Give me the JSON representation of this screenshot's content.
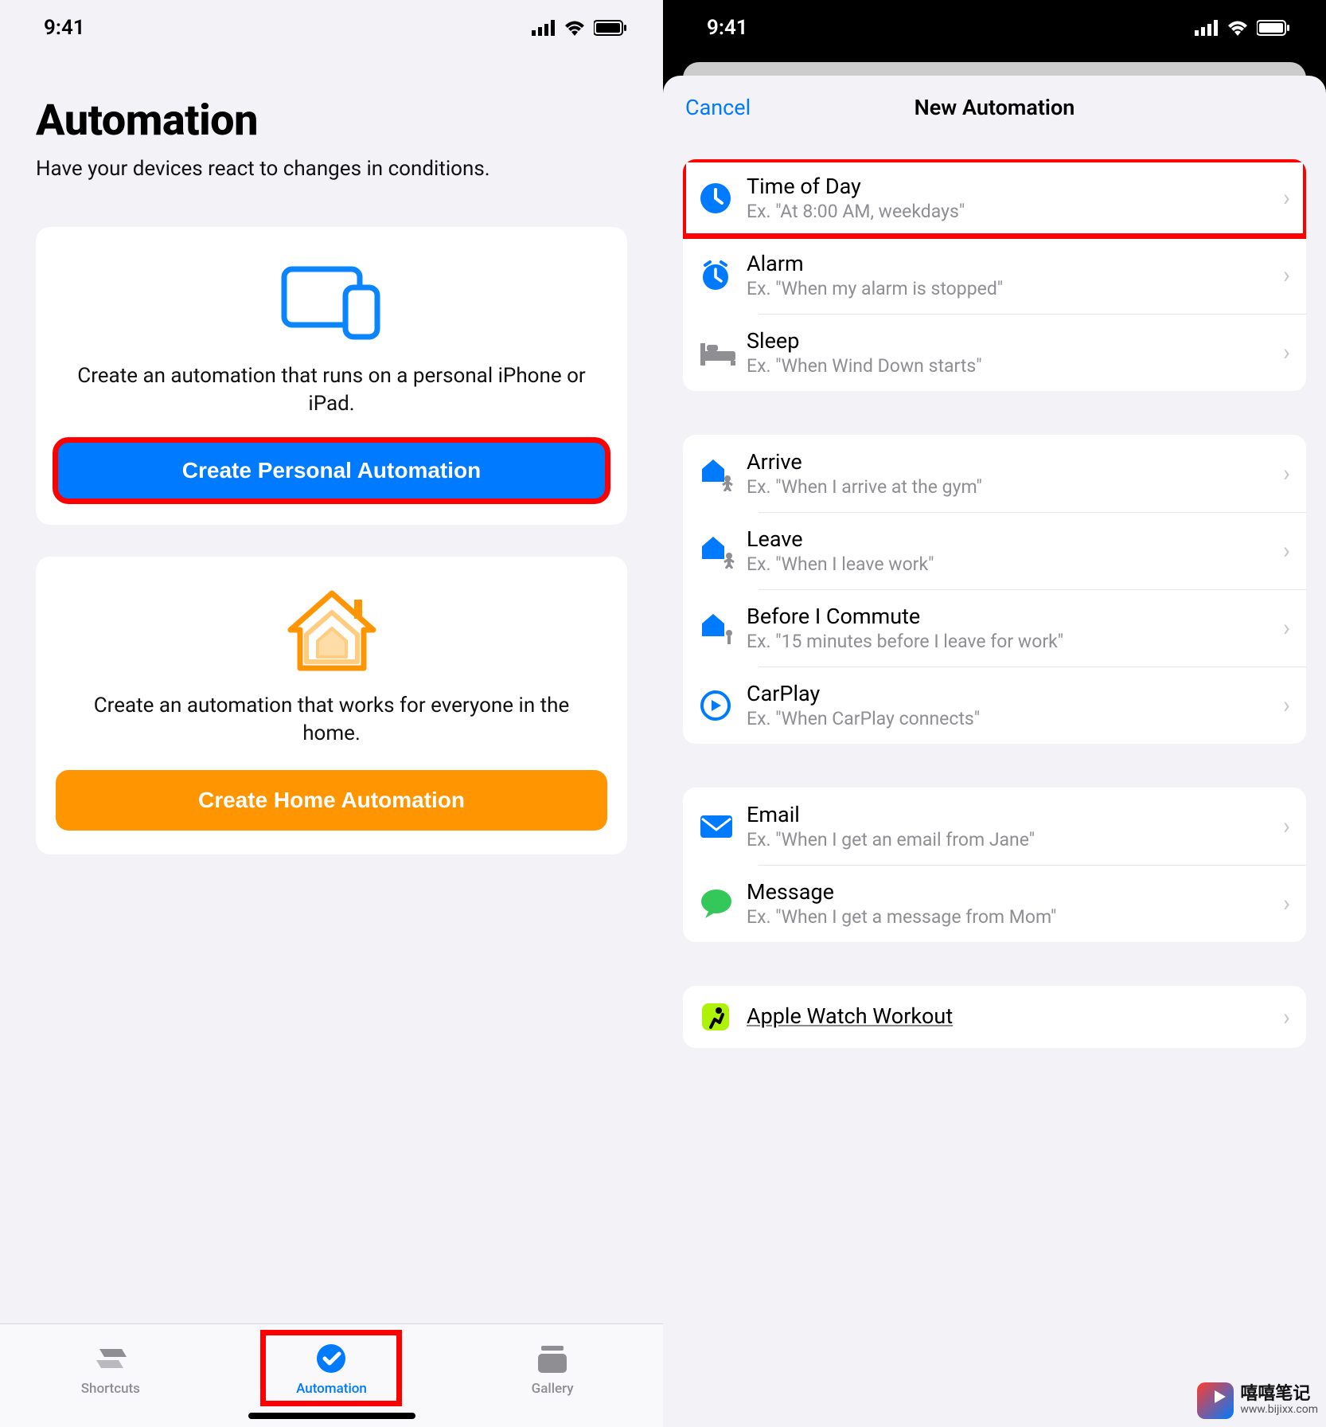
{
  "status": {
    "time": "9:41"
  },
  "left": {
    "title": "Automation",
    "subtitle": "Have your devices react to changes in conditions.",
    "personal": {
      "desc": "Create an automation that runs on a personal iPhone or iPad.",
      "button": "Create Personal Automation"
    },
    "home": {
      "desc": "Create an automation that works for everyone in the home.",
      "button": "Create Home Automation"
    },
    "tabs": {
      "shortcuts": "Shortcuts",
      "automation": "Automation",
      "gallery": "Gallery"
    }
  },
  "right": {
    "cancel": "Cancel",
    "title": "New Automation",
    "rows": {
      "time": {
        "title": "Time of Day",
        "sub": "Ex. \"At 8:00 AM, weekdays\""
      },
      "alarm": {
        "title": "Alarm",
        "sub": "Ex. \"When my alarm is stopped\""
      },
      "sleep": {
        "title": "Sleep",
        "sub": "Ex. \"When Wind Down starts\""
      },
      "arrive": {
        "title": "Arrive",
        "sub": "Ex. \"When I arrive at the gym\""
      },
      "leave": {
        "title": "Leave",
        "sub": "Ex. \"When I leave work\""
      },
      "commute": {
        "title": "Before I Commute",
        "sub": "Ex. \"15 minutes before I leave for work\""
      },
      "carplay": {
        "title": "CarPlay",
        "sub": "Ex. \"When CarPlay connects\""
      },
      "email": {
        "title": "Email",
        "sub": "Ex. \"When I get an email from Jane\""
      },
      "message": {
        "title": "Message",
        "sub": "Ex. \"When I get a message from Mom\""
      },
      "workout": {
        "title": "Apple Watch Workout",
        "sub": ""
      }
    }
  },
  "watermark": {
    "line1": "嘻嘻笔记",
    "line2": "www.bijixx.com"
  }
}
